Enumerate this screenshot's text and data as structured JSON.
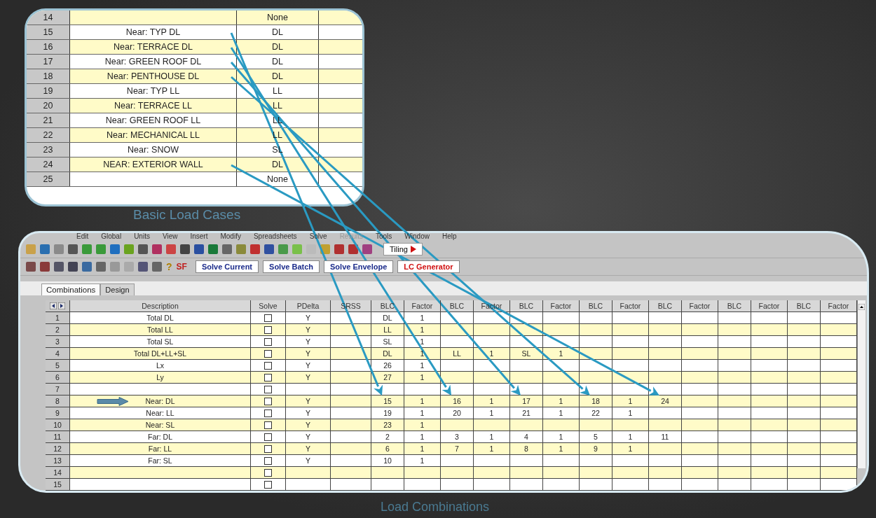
{
  "basic_load_cases": {
    "caption": "Basic Load Cases",
    "rows": [
      {
        "number": "14",
        "category": "None"
      },
      {
        "number": "15",
        "description": "Near: TYP DL",
        "category": "DL"
      },
      {
        "number": "16",
        "description": "Near: TERRACE DL",
        "category": "DL"
      },
      {
        "number": "17",
        "description": "Near: GREEN ROOF DL",
        "category": "DL"
      },
      {
        "number": "18",
        "description": "Near: PENTHOUSE DL",
        "category": "DL"
      },
      {
        "number": "19",
        "description": "Near: TYP LL",
        "category": "LL"
      },
      {
        "number": "20",
        "description": "Near: TERRACE LL",
        "category": "LL"
      },
      {
        "number": "21",
        "description": "Near: GREEN ROOF LL",
        "category": "LL"
      },
      {
        "number": "22",
        "description": "Near: MECHANICAL LL",
        "category": "LL"
      },
      {
        "number": "23",
        "description": "Near: SNOW",
        "category": "SL"
      },
      {
        "number": "24",
        "description": "NEAR: EXTERIOR WALL",
        "category": "DL"
      },
      {
        "number": "25",
        "category": "None"
      }
    ]
  },
  "load_combinations": {
    "caption": "Load Combinations",
    "menu": [
      {
        "label": "Edit",
        "disabled": false
      },
      {
        "label": "Global",
        "disabled": false
      },
      {
        "label": "Units",
        "disabled": false
      },
      {
        "label": "View",
        "disabled": false
      },
      {
        "label": "Insert",
        "disabled": false
      },
      {
        "label": "Modify",
        "disabled": false
      },
      {
        "label": "Spreadsheets",
        "disabled": false
      },
      {
        "label": "Solve",
        "disabled": false
      },
      {
        "label": "Results",
        "disabled": true
      },
      {
        "label": "Tools",
        "disabled": false
      },
      {
        "label": "Window",
        "disabled": false
      },
      {
        "label": "Help",
        "disabled": false
      }
    ],
    "tiling_button": "Tiling",
    "help_glyph": "?",
    "sf_label": "SF",
    "buttons": [
      {
        "label": "Solve Current",
        "kind": "normal"
      },
      {
        "label": "Solve Batch",
        "kind": "normal"
      },
      {
        "label": "Solve Envelope",
        "kind": "normal"
      },
      {
        "label": "LC Generator",
        "kind": "generator"
      }
    ],
    "tabs": [
      {
        "label": "Combinations",
        "selected": true
      },
      {
        "label": "Design",
        "selected": false
      }
    ],
    "columns": [
      "Description",
      "Solve",
      "PDelta",
      "SRSS",
      "BLC",
      "Factor",
      "BLC",
      "Factor",
      "BLC",
      "Factor",
      "BLC",
      "Factor",
      "BLC",
      "Factor",
      "BLC",
      "Factor",
      "BLC",
      "Factor"
    ],
    "rows": [
      {
        "number": "1",
        "description": "Total DL",
        "solve": false,
        "pdelta": "Y",
        "pointer": false,
        "blc": [
          {
            "blc": "DL",
            "factor": "1"
          }
        ]
      },
      {
        "number": "2",
        "description": "Total LL",
        "solve": false,
        "pdelta": "Y",
        "pointer": false,
        "blc": [
          {
            "blc": "LL",
            "factor": "1"
          }
        ]
      },
      {
        "number": "3",
        "description": "Total SL",
        "solve": false,
        "pdelta": "Y",
        "pointer": false,
        "blc": [
          {
            "blc": "SL",
            "factor": "1"
          }
        ]
      },
      {
        "number": "4",
        "description": "Total DL+LL+SL",
        "solve": false,
        "pdelta": "Y",
        "pointer": false,
        "blc": [
          {
            "blc": "DL",
            "factor": "1"
          },
          {
            "blc": "LL",
            "factor": "1"
          },
          {
            "blc": "SL",
            "factor": "1"
          }
        ]
      },
      {
        "number": "5",
        "description": "Lx",
        "solve": false,
        "pdelta": "Y",
        "pointer": false,
        "blc": [
          {
            "blc": "26",
            "factor": "1"
          }
        ]
      },
      {
        "number": "6",
        "description": "Ly",
        "solve": false,
        "pdelta": "Y",
        "pointer": false,
        "blc": [
          {
            "blc": "27",
            "factor": "1"
          }
        ]
      },
      {
        "number": "7",
        "solve": false,
        "pointer": false
      },
      {
        "number": "8",
        "description": "Near: DL",
        "solve": false,
        "pdelta": "Y",
        "pointer": true,
        "blc": [
          {
            "blc": "15",
            "factor": "1"
          },
          {
            "blc": "16",
            "factor": "1"
          },
          {
            "blc": "17",
            "factor": "1"
          },
          {
            "blc": "18",
            "factor": "1"
          },
          {
            "blc": "24"
          }
        ]
      },
      {
        "number": "9",
        "description": "Near: LL",
        "solve": false,
        "pdelta": "Y",
        "pointer": false,
        "blc": [
          {
            "blc": "19",
            "factor": "1"
          },
          {
            "blc": "20",
            "factor": "1"
          },
          {
            "blc": "21",
            "factor": "1"
          },
          {
            "blc": "22",
            "factor": "1"
          }
        ]
      },
      {
        "number": "10",
        "description": "Near: SL",
        "solve": false,
        "pdelta": "Y",
        "pointer": false,
        "blc": [
          {
            "blc": "23",
            "factor": "1"
          }
        ]
      },
      {
        "number": "11",
        "description": "Far: DL",
        "solve": false,
        "pdelta": "Y",
        "pointer": false,
        "blc": [
          {
            "blc": "2",
            "factor": "1"
          },
          {
            "blc": "3",
            "factor": "1"
          },
          {
            "blc": "4",
            "factor": "1"
          },
          {
            "blc": "5",
            "factor": "1"
          },
          {
            "blc": "11"
          }
        ]
      },
      {
        "number": "12",
        "description": "Far: LL",
        "solve": false,
        "pdelta": "Y",
        "pointer": false,
        "blc": [
          {
            "blc": "6",
            "factor": "1"
          },
          {
            "blc": "7",
            "factor": "1"
          },
          {
            "blc": "8",
            "factor": "1"
          },
          {
            "blc": "9",
            "factor": "1"
          }
        ]
      },
      {
        "number": "13",
        "description": "Far: SL",
        "solve": false,
        "pdelta": "Y",
        "pointer": false,
        "blc": [
          {
            "blc": "10",
            "factor": "1"
          }
        ]
      },
      {
        "number": "14",
        "solve": false,
        "pointer": false
      },
      {
        "number": "15",
        "solve": false,
        "pointer": false
      }
    ]
  }
}
